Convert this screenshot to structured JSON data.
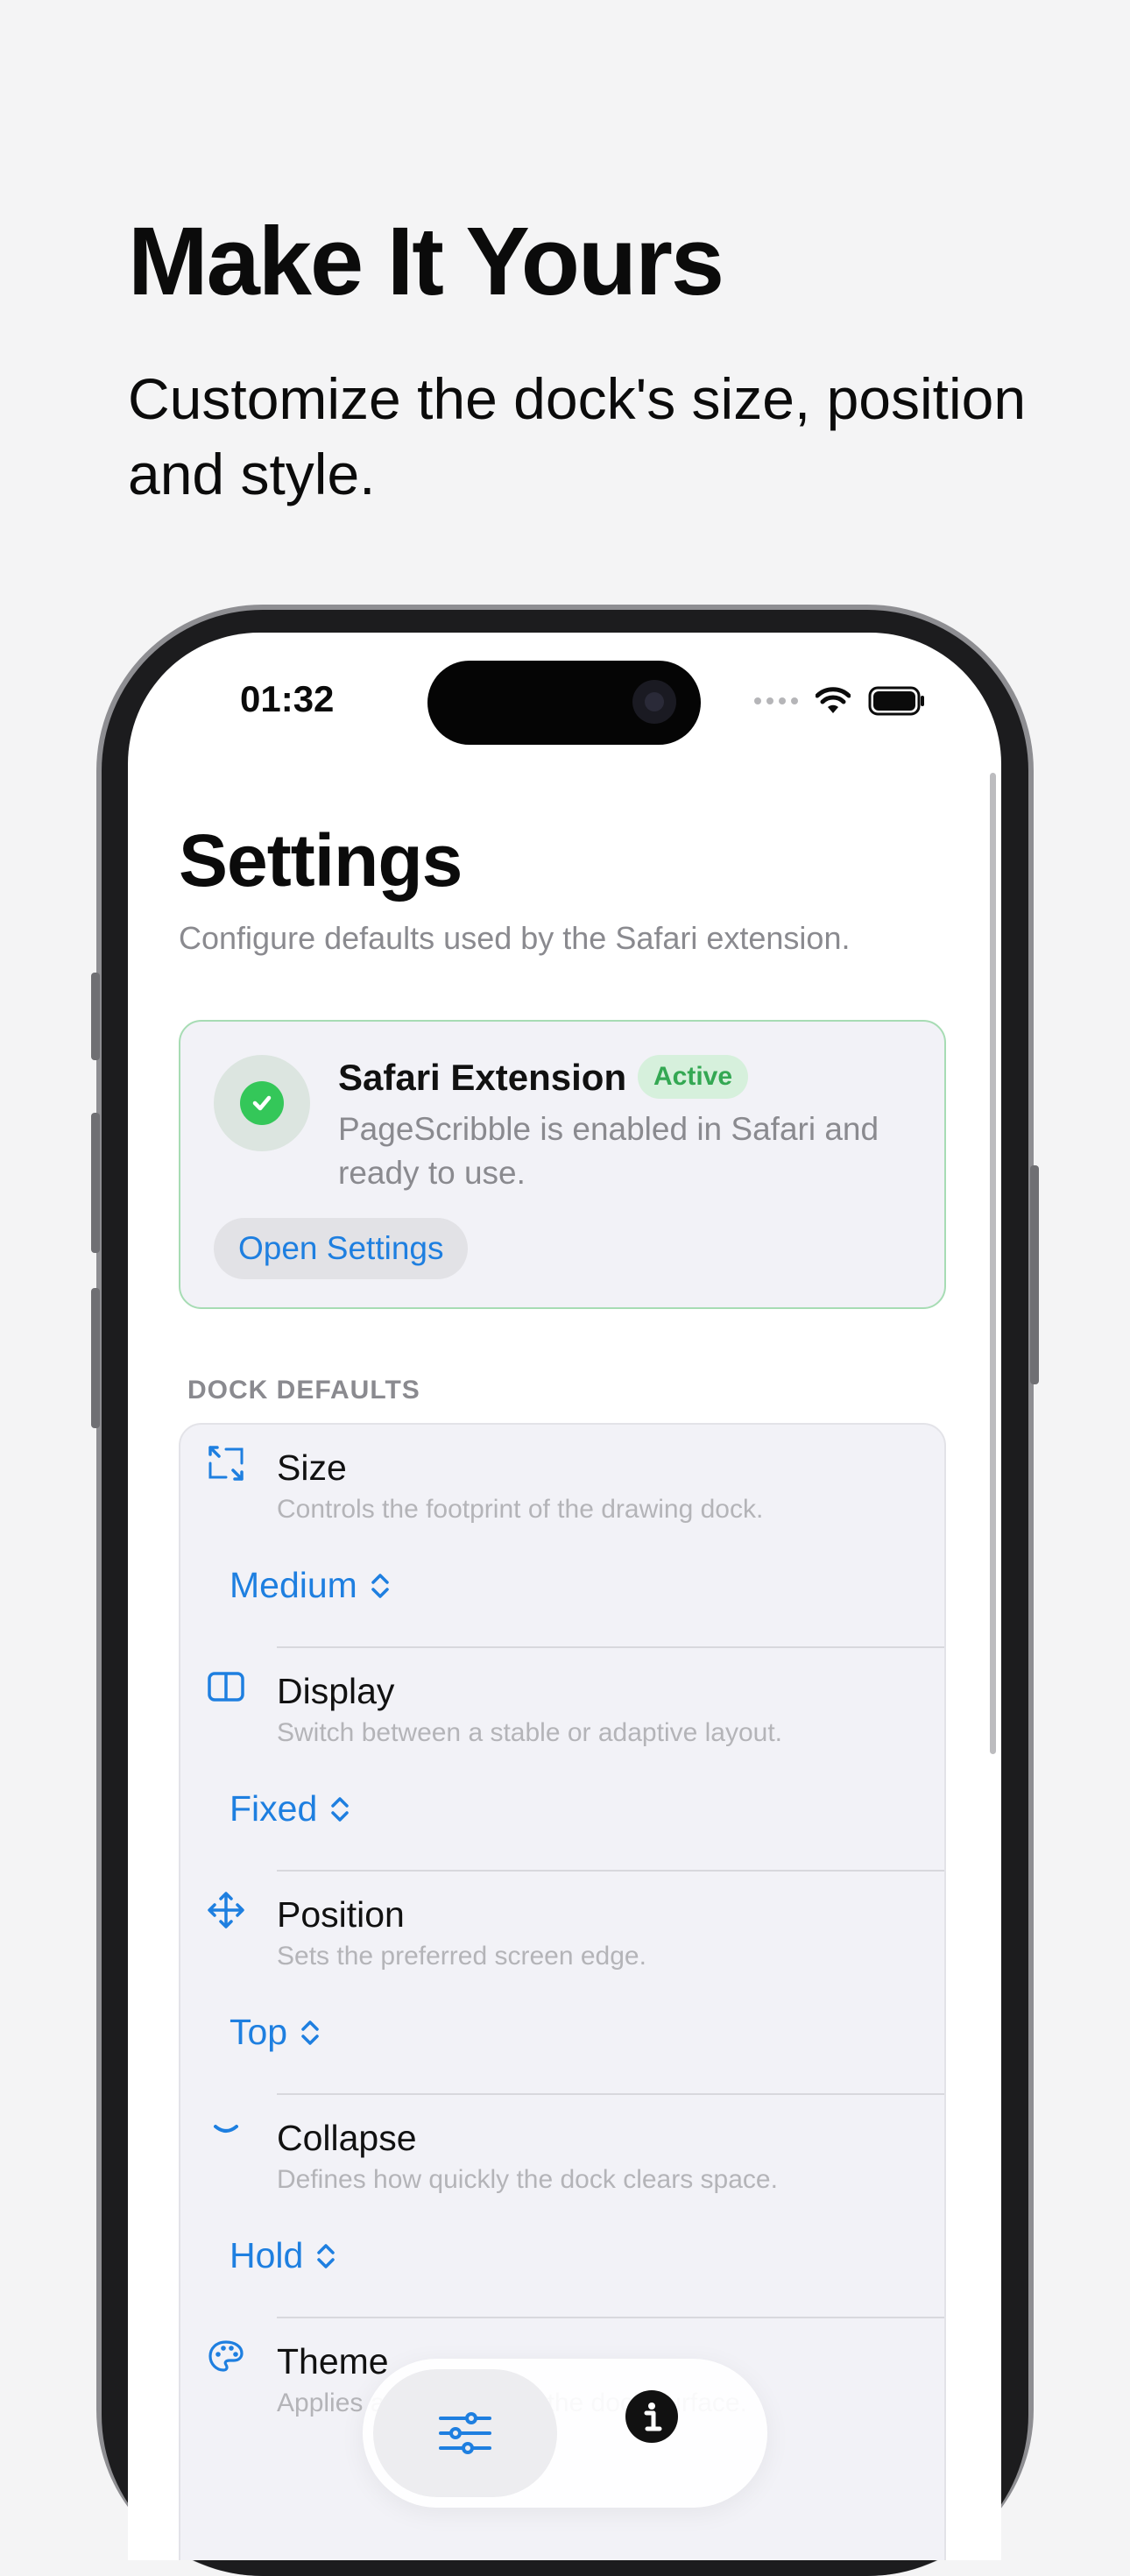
{
  "hero": {
    "title": "Make It Yours",
    "subtitle": "Customize the dock's size, position and style."
  },
  "status_bar": {
    "time": "01:32"
  },
  "settings": {
    "title": "Settings",
    "subtitle": "Configure defaults used by the Safari extension."
  },
  "extension_card": {
    "title": "Safari Extension",
    "badge": "Active",
    "description": "PageScribble is enabled in Safari and ready to use.",
    "button": "Open Settings"
  },
  "dock_defaults": {
    "header": "DOCK DEFAULTS",
    "rows": [
      {
        "icon": "resize-icon",
        "title": "Size",
        "description": "Controls the footprint of the drawing dock.",
        "value": "Medium"
      },
      {
        "icon": "sidebar-icon",
        "title": "Display",
        "description": "Switch between a stable or adaptive layout.",
        "value": "Fixed"
      },
      {
        "icon": "move-arrows-icon",
        "title": "Position",
        "description": "Sets the preferred screen edge.",
        "value": "Top"
      },
      {
        "icon": "chevron-down-icon",
        "title": "Collapse",
        "description": "Defines how quickly the dock clears space.",
        "value": "Hold"
      },
      {
        "icon": "palette-icon",
        "title": "Theme",
        "description": "Applies a color style to the dock surface.",
        "value": ""
      }
    ]
  },
  "tab_bar": {
    "tabs": [
      {
        "icon": "sliders-icon",
        "active": true
      },
      {
        "icon": "info-icon",
        "active": false
      }
    ]
  },
  "colors": {
    "accent": "#1e7fe0",
    "success": "#34c759",
    "background": "#f4f4f5"
  }
}
